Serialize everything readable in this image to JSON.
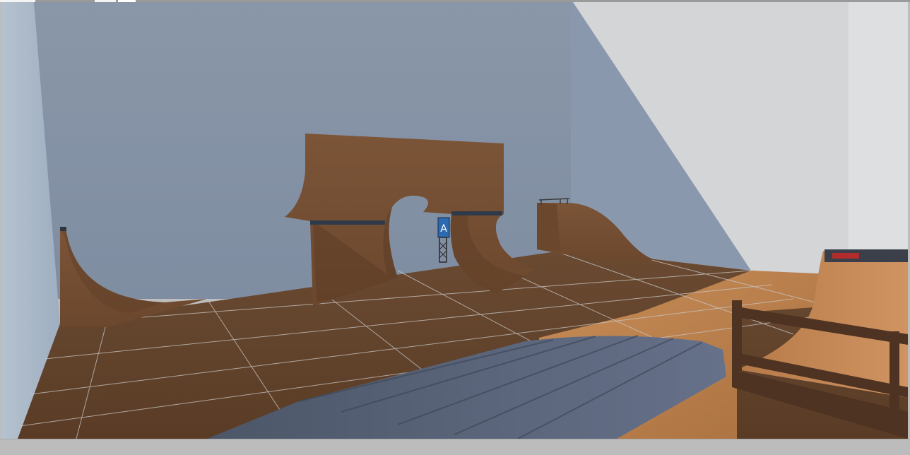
{
  "app": {
    "view": "3d-viewport"
  },
  "colors": {
    "wall_left": "#aab8c8",
    "wall_back": "#8796aa",
    "wall_right_shadow": "#8a98ad",
    "wall_right_lit": "#d4d6d8",
    "floor": "#6e4a30",
    "floor_lit": "#c08552",
    "ramp": "#7a5336",
    "ramp_dark": "#5d3d26",
    "grid": "#c9c9c9",
    "rail_steel": "#596476",
    "fence": "#4e3322"
  },
  "scene": {
    "objects": [
      {
        "name": "left-quarter-pipe",
        "icon": "ramp"
      },
      {
        "name": "arch-wall",
        "icon": "ramp"
      },
      {
        "name": "billboard-tower",
        "icon": "tower"
      },
      {
        "name": "back-right-ramp",
        "icon": "ramp"
      },
      {
        "name": "right-quarter-pipe",
        "icon": "ramp"
      },
      {
        "name": "steel-bank",
        "icon": "rail"
      },
      {
        "name": "wooden-fence",
        "icon": "fence"
      }
    ]
  }
}
